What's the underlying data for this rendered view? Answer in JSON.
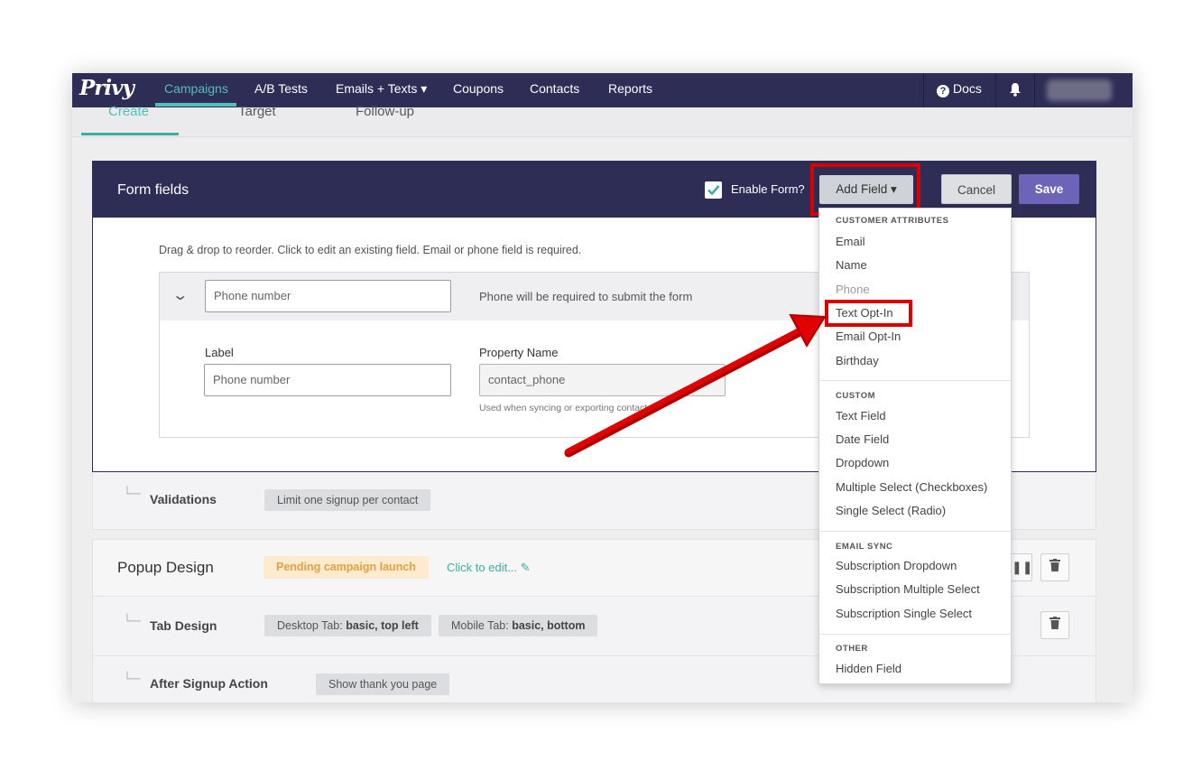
{
  "nav": {
    "logo": "Privy",
    "items": [
      {
        "label": "Campaigns",
        "active": true
      },
      {
        "label": "A/B Tests"
      },
      {
        "label": "Emails + Texts ▾"
      },
      {
        "label": "Coupons"
      },
      {
        "label": "Contacts"
      },
      {
        "label": "Reports"
      }
    ],
    "docs": "Docs",
    "accent": "#4fc0b5"
  },
  "subtabs": [
    "Create",
    "Target",
    "Follow-up"
  ],
  "form_fields": {
    "title": "Form fields",
    "enable_label": "Enable Form?",
    "add_field": "Add Field ▾",
    "cancel": "Cancel",
    "save": "Save",
    "hint": "Drag & drop to reorder. Click to edit an existing field. Email or phone field is required.",
    "field": {
      "value": "Phone number",
      "required_text": "Phone will be required to submit the form",
      "label_title": "Label",
      "label_value": "Phone number",
      "property_title": "Property Name",
      "property_value": "contact_phone",
      "property_note": "Used when syncing or exporting contacts"
    }
  },
  "validations": {
    "label": "Validations",
    "pill": "Limit one signup per contact"
  },
  "popup_design": {
    "label": "Popup Design",
    "status": "Pending campaign launch",
    "edit": "Click to edit..."
  },
  "tab_design": {
    "label": "Tab Design",
    "desktop_prefix": "Desktop Tab:",
    "desktop_value": "basic, top left",
    "mobile_prefix": "Mobile Tab:",
    "mobile_value": "basic, bottom"
  },
  "after_signup": {
    "label": "After Signup Action",
    "pill": "Show thank you page"
  },
  "dropdown": {
    "sections": [
      {
        "heading": "CUSTOMER ATTRIBUTES",
        "items": [
          "Email",
          "Name",
          "Phone",
          "Text Opt-In",
          "Email Opt-In",
          "Birthday"
        ]
      },
      {
        "heading": "CUSTOM",
        "items": [
          "Text Field",
          "Date Field",
          "Dropdown",
          "Multiple Select (Checkboxes)",
          "Single Select (Radio)"
        ]
      },
      {
        "heading": "EMAIL SYNC",
        "items": [
          "Subscription Dropdown",
          "Subscription Multiple Select",
          "Subscription Single Select"
        ]
      },
      {
        "heading": "OTHER",
        "items": [
          "Hidden Field"
        ]
      }
    ]
  },
  "colors": {
    "header": "#2e2d55",
    "highlight": "#d90000",
    "save": "#6c64b9",
    "pending": "#e4a042"
  }
}
